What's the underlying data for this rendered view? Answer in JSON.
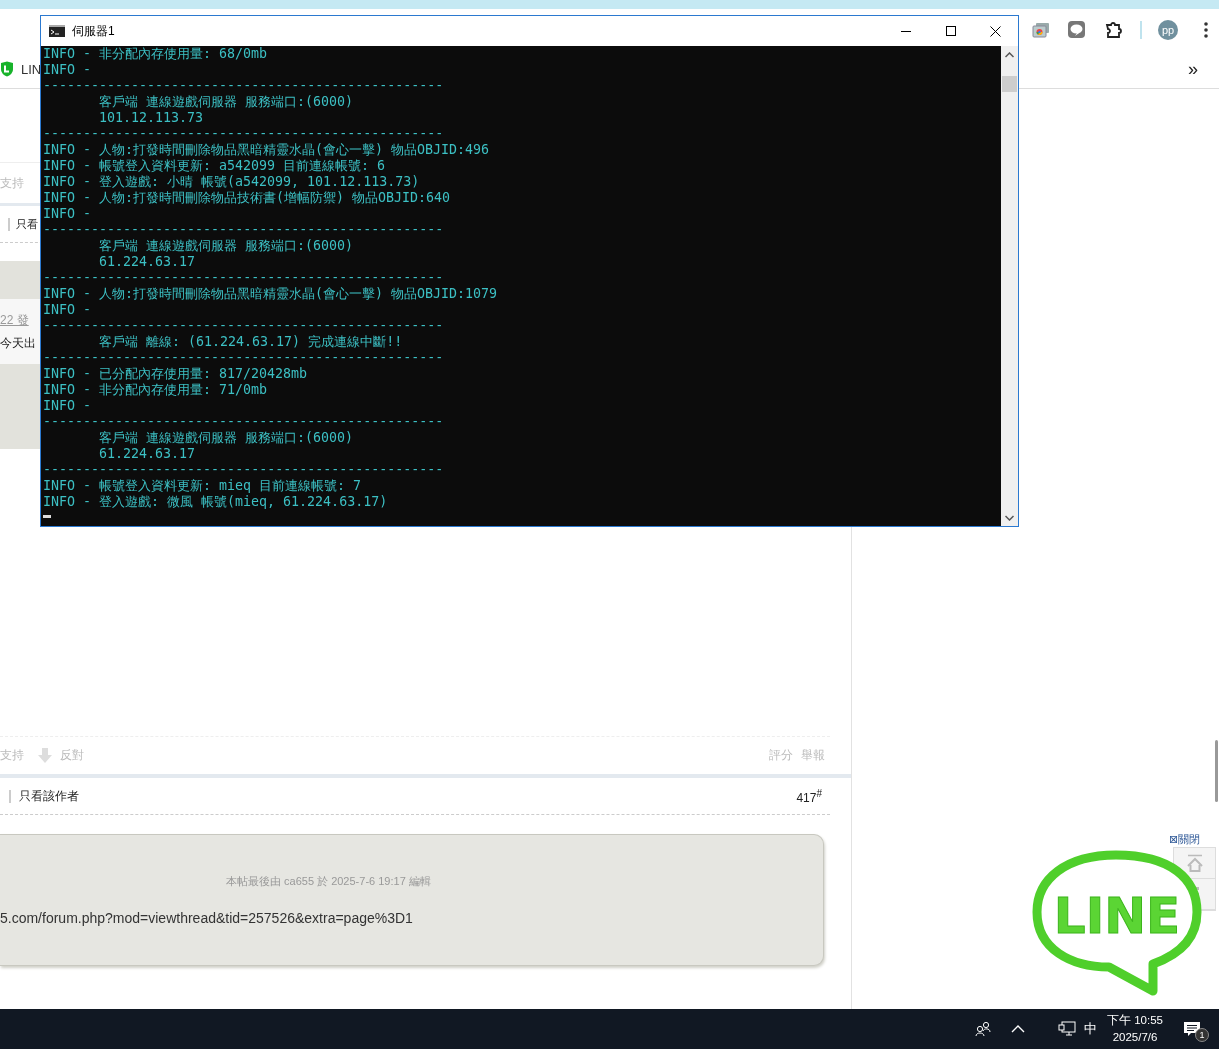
{
  "browser": {
    "tab_label": "LIN",
    "avatar": "pp",
    "bookmarks_overflow": "»"
  },
  "page": {
    "earlier_post": {
      "support": "支持",
      "author_filter": "只看",
      "post_time": "22 發",
      "body": "今天出"
    },
    "vote_actions": {
      "support": "支持",
      "oppose": "反對"
    },
    "post_actions": [
      "評分",
      "舉報"
    ],
    "author_filter": "只看該作者",
    "floor": "417$^{#}$",
    "edit_note": "本帖最後由 ca655 於 2025-7-6 19:17 編輯",
    "link": "5.com/forum.php?mod=viewthread&tid=257526&extra=page%3D1"
  },
  "float_ad": {
    "close": "⊠關閉",
    "logo": "LINE"
  },
  "console": {
    "title": "伺服器1",
    "lines": [
      "INFO - 非分配內存使用量: 68/0mb",
      "INFO -",
      "--------------------------------------------------",
      "       客戶端 連線遊戲伺服器 服務端口:(6000)",
      "       101.12.113.73",
      "--------------------------------------------------",
      "INFO - 人物:打發時間刪除物品黑暗精靈水晶(會心一擊) 物品OBJID:496",
      "INFO - 帳號登入資料更新: a542099 目前連線帳號: 6",
      "INFO - 登入遊戲: 小晴 帳號(a542099, 101.12.113.73)",
      "INFO - 人物:打發時間刪除物品技術書(增幅防禦) 物品OBJID:640",
      "INFO -",
      "--------------------------------------------------",
      "       客戶端 連線遊戲伺服器 服務端口:(6000)",
      "       61.224.63.17",
      "--------------------------------------------------",
      "INFO - 人物:打發時間刪除物品黑暗精靈水晶(會心一擊) 物品OBJID:1079",
      "INFO -",
      "--------------------------------------------------",
      "       客戶端 離線: (61.224.63.17) 完成連線中斷!!",
      "--------------------------------------------------",
      "INFO - 已分配內存使用量: 817/20428mb",
      "INFO - 非分配內存使用量: 71/0mb",
      "INFO -",
      "--------------------------------------------------",
      "       客戶端 連線遊戲伺服器 服務端口:(6000)",
      "       61.224.63.17",
      "--------------------------------------------------",
      "INFO - 帳號登入資料更新: mieq 目前連線帳號: 7",
      "INFO - 登入遊戲: 微風 帳號(mieq, 61.224.63.17)"
    ]
  },
  "taskbar": {
    "ime": "中",
    "time": "下午 10:55",
    "date": "2025/7/6",
    "notifications": "1"
  }
}
